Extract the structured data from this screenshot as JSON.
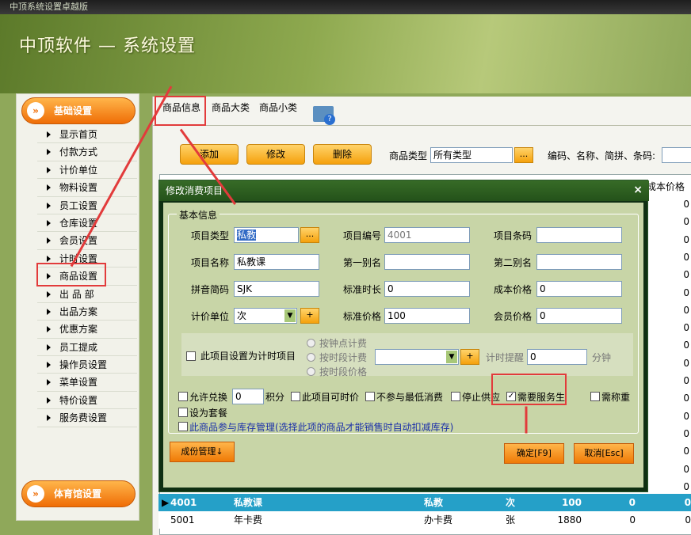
{
  "window": {
    "title": "中顶系统设置卓越版"
  },
  "header": {
    "app_title": "中顶软件 — 系统设置"
  },
  "sidebar": {
    "section1": "基础设置",
    "section2": "体育馆设置",
    "items": [
      {
        "label": "显示首页"
      },
      {
        "label": "付款方式"
      },
      {
        "label": "计价单位"
      },
      {
        "label": "物料设置"
      },
      {
        "label": "员工设置"
      },
      {
        "label": "仓库设置"
      },
      {
        "label": "会员设置"
      },
      {
        "label": "计时设置"
      },
      {
        "label": "商品设置"
      },
      {
        "label": "出 品 部"
      },
      {
        "label": "出品方案"
      },
      {
        "label": "优惠方案"
      },
      {
        "label": "员工提成"
      },
      {
        "label": "操作员设置"
      },
      {
        "label": "菜单设置"
      },
      {
        "label": "特价设置"
      },
      {
        "label": "服务费设置"
      }
    ]
  },
  "tabs": {
    "t1": "商品信息",
    "t2": "商品大类",
    "t3": "商品小类"
  },
  "toolbar": {
    "add": "添加",
    "edit": "修改",
    "delete": "删除",
    "type_label": "商品类型",
    "type_value": "所有类型",
    "dots": "...",
    "search_label": "编码、名称、简拼、条码:"
  },
  "table": {
    "col_cost": "成本价格"
  },
  "dialog": {
    "title": "修改消费项目",
    "group": "基本信息",
    "f_type": "项目类型",
    "v_type": "私教",
    "f_code": "项目编号",
    "v_code": "4001",
    "f_barcode": "项目条码",
    "f_name": "项目名称",
    "v_name": "私教课",
    "f_alias1": "第一别名",
    "f_alias2": "第二别名",
    "f_pinyin": "拼音简码",
    "v_pinyin": "SJK",
    "f_stdtime": "标准时长",
    "v_stdtime": "0",
    "f_cost": "成本价格",
    "v_cost": "0",
    "f_unit": "计价单位",
    "v_unit": "次",
    "f_stdprice": "标准价格",
    "v_stdprice": "100",
    "f_member": "会员价格",
    "v_member": "0",
    "plus": "+",
    "timed": "此项目设置为计时项目",
    "r1": "按钟点计费",
    "r2": "按时段计费",
    "r3": "按时段价格",
    "remind": "计时提醒",
    "v_remind": "0",
    "minute": "分钟",
    "c_redeem": "允许兑换",
    "v_points": "0",
    "points": "积分",
    "c_timeprice": "此项目可时价",
    "c_nomin": "不参与最低消费",
    "c_stop": "停止供应",
    "c_service": "需要服务生",
    "c_weigh": "需称重",
    "c_set": "设为套餐",
    "c_stock": "此商品参与库存管理(选择此项的商品才能销售时自动扣减库存)",
    "cost_mgmt": "成份管理↓",
    "ok": "确定[F9]",
    "cancel": "取消[Esc]",
    "check": "✓"
  },
  "rows": [
    {
      "code": "4001",
      "name": "私教课",
      "type": "私教",
      "unit": "次",
      "price": "100",
      "a": "0",
      "b": "0"
    },
    {
      "code": "5001",
      "name": "年卡费",
      "type": "办卡费",
      "unit": "张",
      "price": "1880",
      "a": "0",
      "b": "0"
    }
  ],
  "cost_col_zeros": [
    "0",
    "0",
    "0",
    "0",
    "0",
    "0",
    "0",
    "0",
    "0",
    "0",
    "0",
    "0",
    "0",
    "0",
    "0",
    "0",
    "0"
  ]
}
